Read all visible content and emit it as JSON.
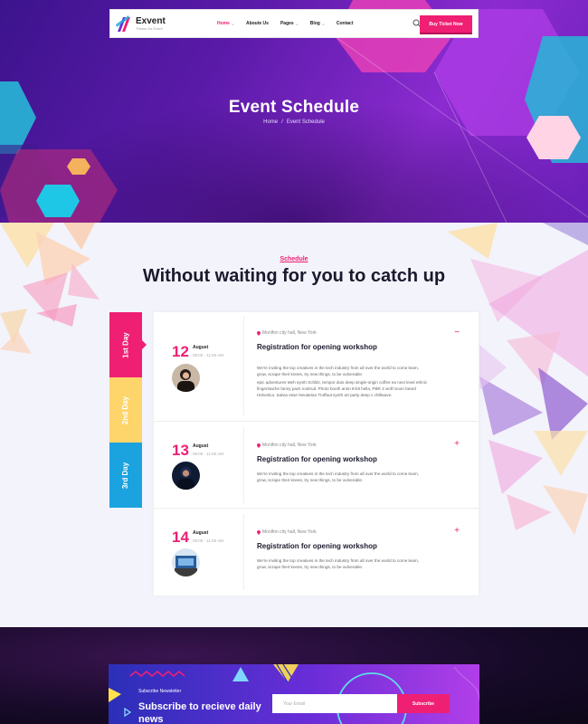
{
  "brand": {
    "name": "Exvent",
    "tagline": "Theme for Event"
  },
  "nav": {
    "items": [
      {
        "label": "Home",
        "dropdown": true,
        "active": true
      },
      {
        "label": "Aboute Us",
        "dropdown": false,
        "active": false
      },
      {
        "label": "Pages",
        "dropdown": true,
        "active": false
      },
      {
        "label": "Blog",
        "dropdown": true,
        "active": false
      },
      {
        "label": "Contact",
        "dropdown": false,
        "active": false
      }
    ],
    "cart_count": "0",
    "buy_label": "Buy Ticket Now"
  },
  "hero": {
    "title": "Event Schedule",
    "breadcrumb": [
      "Home",
      "/",
      "Event Schedule"
    ]
  },
  "schedule": {
    "label": "Schedule",
    "title": "Without waiting for you to catch up",
    "days": [
      {
        "label": "1st Day",
        "color": "#ef1f73"
      },
      {
        "label": "2nd Day",
        "color": "#fdd56b"
      },
      {
        "label": "3rd Day",
        "color": "#1ba3e0"
      }
    ],
    "sessions": [
      {
        "day": "12",
        "month": "August",
        "time": "09:00 - 11:00 AM",
        "location": "Monlfon city hall, New York",
        "title": "Registration for opening workshop",
        "desc1": "We're inviting the top creatives in the tech industry from all over the world to come learn, grow, scrape their knees, try new things, to be vulnerable.",
        "desc2": "epic adventures Meh synth Schlitz, tempor duis deep single-origin coffee ea next level ethnic fingerstache fanny pack nostrud. Photo booth anim 8-bit hella, PBR 3 wolf moon beard Helvetica. Salvia esse Neutarian Truffaut synth art party deep v chillwave.",
        "toggle": "−",
        "expanded": true
      },
      {
        "day": "13",
        "month": "August",
        "time": "09:00 - 11:00 AM",
        "location": "Monlfon city hall, New York",
        "title": "Registration for opening workshop",
        "desc1": "We're inviting the top creatives in the tech industry from all over the world to come learn, grow, scrape their knees, try new things, to be vulnerable.",
        "toggle": "+",
        "expanded": false
      },
      {
        "day": "14",
        "month": "August",
        "time": "09:00 - 11:00 AM",
        "location": "Monlfon city hall, New York",
        "title": "Registration for opening workshop",
        "desc1": "We're inviting the top creatives in the tech industry from all over the world to come learn, grow, scrape their knees, try new things, to be vulnerable.",
        "toggle": "+",
        "expanded": false
      }
    ]
  },
  "newsletter": {
    "eyebrow": "Subscribe Newsletter",
    "title": "Subscribe to recieve daily news",
    "placeholder": "Your Email",
    "button": "Subscribe"
  },
  "colors": {
    "accent": "#ef1f73",
    "yellow": "#fdd56b",
    "blue": "#1ba3e0",
    "purple": "#6a2dd8"
  }
}
